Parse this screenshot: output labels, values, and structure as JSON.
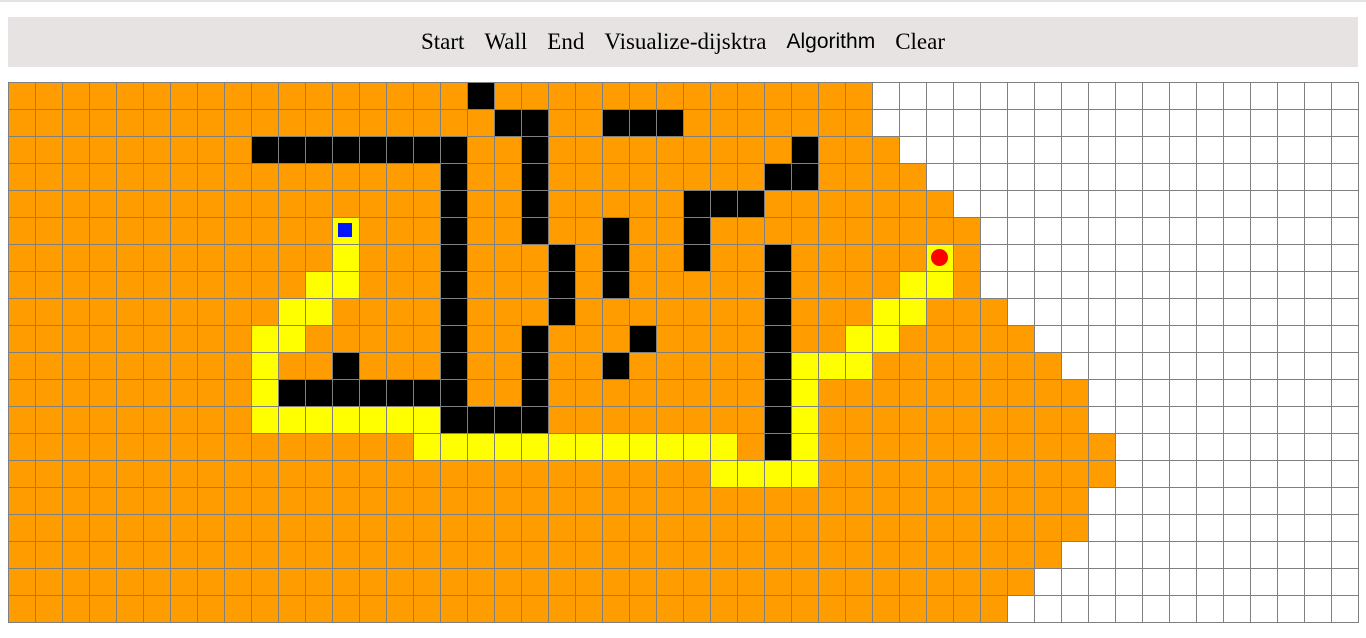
{
  "toolbar": {
    "start_label": "Start",
    "wall_label": "Wall",
    "end_label": "End",
    "visualize_label": "Visualize-dijsktra",
    "algorithm_label": "Algorithm",
    "clear_label": "Clear"
  },
  "grid": {
    "rows": 20,
    "cols": 50,
    "visited_extent": [
      31,
      31,
      32,
      33,
      34,
      35,
      35,
      35,
      36,
      37,
      38,
      39,
      39,
      40,
      40,
      39,
      39,
      38,
      37,
      36
    ],
    "walls": [
      [
        0,
        17
      ],
      [
        1,
        18
      ],
      [
        1,
        19
      ],
      [
        1,
        22
      ],
      [
        1,
        23
      ],
      [
        1,
        24
      ],
      [
        2,
        9
      ],
      [
        2,
        10
      ],
      [
        2,
        11
      ],
      [
        2,
        12
      ],
      [
        2,
        13
      ],
      [
        2,
        14
      ],
      [
        2,
        15
      ],
      [
        2,
        16
      ],
      [
        2,
        19
      ],
      [
        2,
        29
      ],
      [
        3,
        16
      ],
      [
        3,
        19
      ],
      [
        3,
        28
      ],
      [
        3,
        29
      ],
      [
        4,
        16
      ],
      [
        4,
        19
      ],
      [
        4,
        25
      ],
      [
        4,
        26
      ],
      [
        4,
        27
      ],
      [
        5,
        16
      ],
      [
        5,
        19
      ],
      [
        5,
        22
      ],
      [
        5,
        25
      ],
      [
        6,
        16
      ],
      [
        6,
        20
      ],
      [
        6,
        22
      ],
      [
        6,
        25
      ],
      [
        6,
        28
      ],
      [
        7,
        16
      ],
      [
        7,
        20
      ],
      [
        7,
        22
      ],
      [
        7,
        28
      ],
      [
        8,
        16
      ],
      [
        8,
        20
      ],
      [
        8,
        28
      ],
      [
        9,
        16
      ],
      [
        9,
        19
      ],
      [
        9,
        23
      ],
      [
        9,
        28
      ],
      [
        10,
        12
      ],
      [
        10,
        16
      ],
      [
        10,
        19
      ],
      [
        10,
        22
      ],
      [
        10,
        28
      ],
      [
        11,
        10
      ],
      [
        11,
        11
      ],
      [
        11,
        12
      ],
      [
        11,
        13
      ],
      [
        11,
        14
      ],
      [
        11,
        15
      ],
      [
        11,
        16
      ],
      [
        11,
        19
      ],
      [
        11,
        28
      ],
      [
        12,
        16
      ],
      [
        12,
        17
      ],
      [
        12,
        18
      ],
      [
        12,
        19
      ],
      [
        12,
        28
      ],
      [
        13,
        28
      ]
    ],
    "path": [
      [
        6,
        12
      ],
      [
        7,
        11
      ],
      [
        7,
        12
      ],
      [
        8,
        10
      ],
      [
        8,
        11
      ],
      [
        9,
        9
      ],
      [
        9,
        10
      ],
      [
        10,
        9
      ],
      [
        11,
        9
      ],
      [
        12,
        9
      ],
      [
        12,
        10
      ],
      [
        12,
        11
      ],
      [
        12,
        12
      ],
      [
        12,
        13
      ],
      [
        12,
        14
      ],
      [
        12,
        15
      ],
      [
        13,
        15
      ],
      [
        13,
        16
      ],
      [
        13,
        17
      ],
      [
        13,
        18
      ],
      [
        13,
        19
      ],
      [
        13,
        20
      ],
      [
        13,
        21
      ],
      [
        13,
        22
      ],
      [
        13,
        23
      ],
      [
        13,
        24
      ],
      [
        13,
        25
      ],
      [
        13,
        26
      ],
      [
        14,
        26
      ],
      [
        14,
        27
      ],
      [
        14,
        28
      ],
      [
        14,
        29
      ],
      [
        13,
        29
      ],
      [
        12,
        29
      ],
      [
        11,
        29
      ],
      [
        10,
        29
      ],
      [
        10,
        30
      ],
      [
        10,
        31
      ],
      [
        9,
        31
      ],
      [
        9,
        32
      ],
      [
        8,
        32
      ],
      [
        8,
        33
      ],
      [
        7,
        33
      ],
      [
        7,
        34
      ]
    ],
    "start": [
      5,
      12
    ],
    "end": [
      6,
      34
    ],
    "colors": {
      "visited": "#ff9c00",
      "wall": "#000000",
      "path": "#ffff00",
      "unvisited": "#ffffff",
      "start": "#0016ff",
      "end": "#ff0000",
      "toolbar": "#e6e3e2"
    }
  }
}
